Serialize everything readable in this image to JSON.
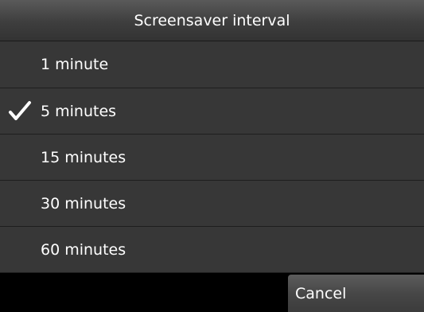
{
  "dialog": {
    "title": "Screensaver interval"
  },
  "options": [
    {
      "label": "1 minute",
      "selected": false
    },
    {
      "label": "5 minutes",
      "selected": true
    },
    {
      "label": "15 minutes",
      "selected": false
    },
    {
      "label": "30 minutes",
      "selected": false
    },
    {
      "label": "60 minutes",
      "selected": false
    }
  ],
  "buttons": {
    "cancel_label": "Cancel"
  },
  "icons": {
    "selected_marker": "checkmark-icon"
  },
  "colors": {
    "row_background": "#373737",
    "row_divider": "#1e1e1e",
    "text": "#ffffff",
    "background": "#000000"
  }
}
